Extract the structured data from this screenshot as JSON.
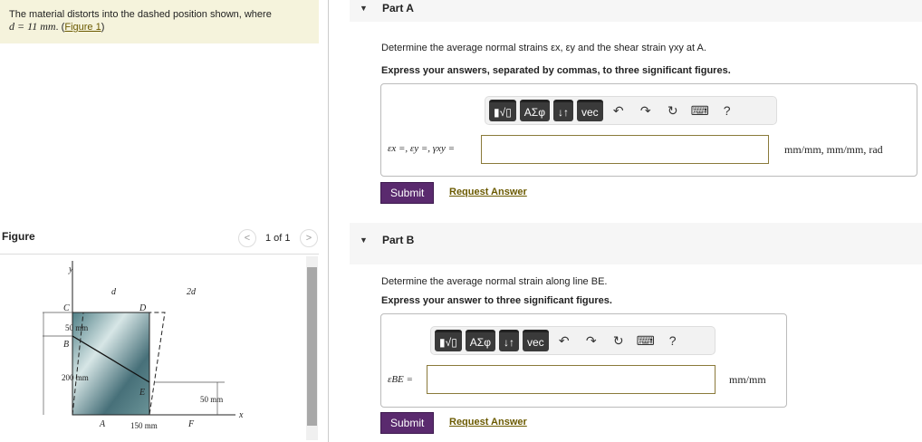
{
  "intro": {
    "text": "The material distorts into the dashed position shown, where",
    "math": "d = 11 mm",
    "period": ".",
    "link": "Figure 1"
  },
  "figure": {
    "title": "Figure",
    "pager": "1 of 1",
    "prev": "<",
    "next": ">",
    "labels": {
      "y": "y",
      "x": "x",
      "d": "d",
      "d2": "2d",
      "C": "C",
      "D": "D",
      "B": "B",
      "E": "E",
      "A": "A",
      "F": "F",
      "dim50a": "50 mm",
      "dim200": "200 mm",
      "dim50b": "50 mm",
      "dim150": "150 mm"
    }
  },
  "toolbar": {
    "templates": "▮√▯",
    "greek": "ΑΣφ",
    "arrows": "↓↑",
    "vec": "vec",
    "help": "?"
  },
  "partA": {
    "title": "Part A",
    "question": "Determine the average normal strains εx, εy and the shear strain γxy at A.",
    "instruction": "Express your answers, separated by commas, to three significant figures.",
    "label": "εx =, εy =, γxy =",
    "value": "",
    "units": "mm/mm, mm/mm, rad",
    "submit": "Submit",
    "request": "Request Answer"
  },
  "partB": {
    "title": "Part B",
    "question": "Determine the average normal strain along line BE.",
    "instruction": "Express your answer to three significant figures.",
    "label": "εBE =",
    "value": "",
    "units": "mm/mm",
    "submit": "Submit",
    "request": "Request Answer"
  }
}
